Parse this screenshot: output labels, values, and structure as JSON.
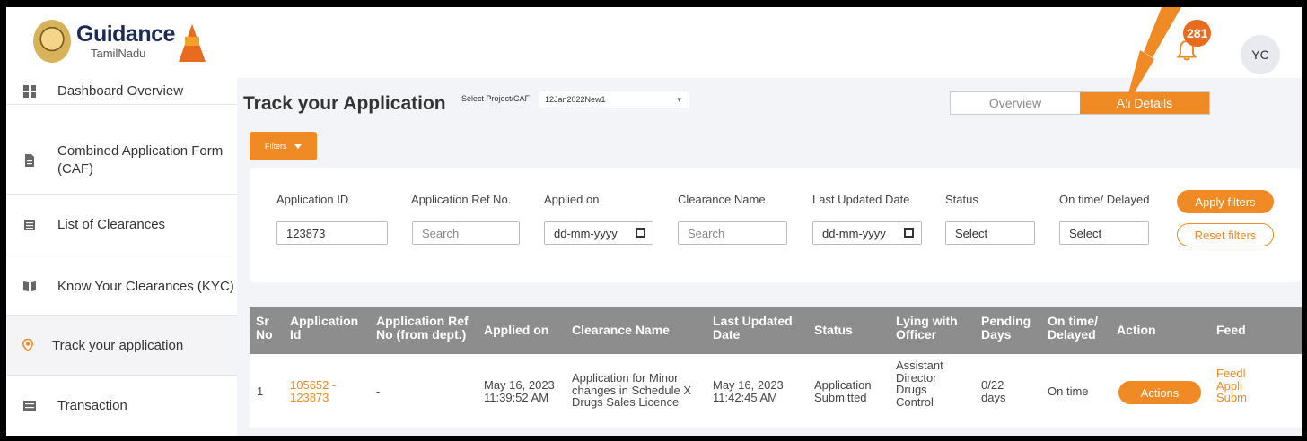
{
  "header": {
    "brand_name": "Guidance",
    "brand_sub": "TamilNadu",
    "notification_count": "281",
    "avatar_initials": "YC"
  },
  "sidebar": {
    "items": [
      {
        "label": "Dashboard Overview",
        "icon": "dashboard-icon"
      },
      {
        "label": "Combined Application Form (CAF)",
        "icon": "document-icon"
      },
      {
        "label": "List of Clearances",
        "icon": "list-icon"
      },
      {
        "label": "Know Your Clearances (KYC)",
        "icon": "book-icon"
      },
      {
        "label": "Track your application",
        "icon": "location-pin-icon",
        "active": true
      },
      {
        "label": "Transaction",
        "icon": "transaction-icon"
      }
    ]
  },
  "main": {
    "title": "Track your Application",
    "select_label": "Select Project/CAF",
    "select_value": "12Jan2022New1",
    "tabs": [
      {
        "label": "Overview",
        "active": false
      },
      {
        "label": "All Details",
        "active": true
      }
    ],
    "filters_label": "Filters"
  },
  "filters": {
    "application_id": {
      "label": "Application ID",
      "value": "123873"
    },
    "ref_no": {
      "label": "Application Ref No.",
      "placeholder": "Search"
    },
    "applied_on": {
      "label": "Applied on",
      "value": "dd-mm-yyyy"
    },
    "clearance_name": {
      "label": "Clearance Name",
      "placeholder": "Search"
    },
    "last_updated": {
      "label": "Last Updated Date",
      "value": "dd-mm-yyyy"
    },
    "status": {
      "label": "Status",
      "value": "Select"
    },
    "ontime": {
      "label": "On time/ Delayed",
      "value": "Select"
    },
    "apply_label": "Apply filters",
    "reset_label": "Reset filters"
  },
  "table": {
    "headers": {
      "sr": [
        "Sr",
        "No"
      ],
      "app_id": [
        "Application",
        "Id"
      ],
      "ref": [
        "Application Ref",
        "No (from dept.)"
      ],
      "applied": "Applied on",
      "clearance": "Clearance Name",
      "updated": [
        "Last Updated",
        "Date"
      ],
      "status": "Status",
      "lying": [
        "Lying with",
        "Officer"
      ],
      "pending": [
        "Pending",
        "Days"
      ],
      "ontime": [
        "On time/",
        "Delayed"
      ],
      "action": "Action",
      "feedback": "Feed"
    },
    "rows": [
      {
        "sr": "1",
        "app_id": [
          "105652 -",
          "123873"
        ],
        "ref": "-",
        "applied": [
          "May 16, 2023",
          "11:39:52 AM"
        ],
        "clearance": [
          "Application for Minor",
          "changes in Schedule X",
          "Drugs Sales Licence"
        ],
        "updated": [
          "May 16, 2023",
          "11:42:45 AM"
        ],
        "status": [
          "Application",
          "Submitted"
        ],
        "lying": [
          "Assistant",
          "Director",
          "Drugs",
          "Control"
        ],
        "pending": [
          "0/22",
          "days"
        ],
        "ontime": "On time",
        "action_label": "Actions",
        "feedback": [
          "Feedl",
          "Appli",
          "Subm"
        ]
      }
    ]
  },
  "colors": {
    "accent": "#ef8a24",
    "table_header": "#8d8d8d",
    "brand_navy": "#1c2b53"
  }
}
